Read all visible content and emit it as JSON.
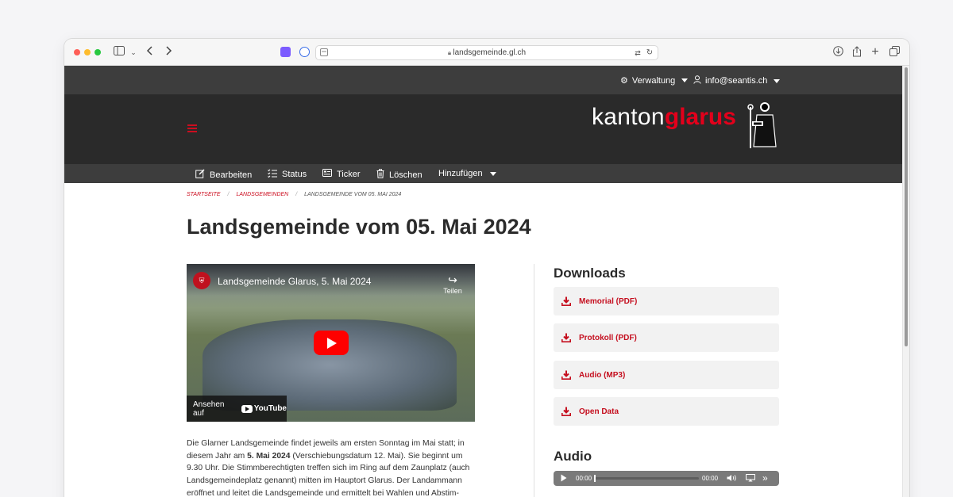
{
  "browser": {
    "url": "landsgemeinde.gl.ch"
  },
  "topbar": {
    "admin_label": "Verwaltung",
    "user_label": "info@seantis.ch"
  },
  "logo": {
    "part1": "kanton",
    "part2": "glarus"
  },
  "actions": [
    {
      "label": "Bearbeiten",
      "icon": "edit-icon"
    },
    {
      "label": "Status",
      "icon": "list-check-icon"
    },
    {
      "label": "Ticker",
      "icon": "ticker-icon"
    },
    {
      "label": "Löschen",
      "icon": "trash-icon"
    },
    {
      "label": "Hinzufügen",
      "icon": "chevron-down-icon"
    }
  ],
  "breadcrumb": [
    "Startseite",
    "Landsgemeinden",
    "Landsgemeinde vom 05. Mai 2024"
  ],
  "page_title": "Landsgemeinde vom 05. Mai 2024",
  "video": {
    "title": "Landsgemeinde Glarus, 5. Mai 2024",
    "share_label": "Teilen",
    "watch_label": "Ansehen auf",
    "platform": "YouTube"
  },
  "intro": {
    "p1": "Die Glarner Landsgemeinde findet jeweils am ersten Sonntag im Mai statt; in diesem Jahr am ",
    "date_bold": "5. Mai 2024",
    "p2": " (Verschiebungsdatum 12. Mai). Sie beginnt um 9.30 Uhr. Die Stimmberechtigten treffen sich im Ring auf dem Zaunplatz (auch Landsgemeindeplatz genannt) mitten im Hauptort Glarus. Der Landammann eröffnet und leitet die Landsgemeinde und ermittelt bei Wahlen und Abstim-"
  },
  "downloads": {
    "heading": "Downloads",
    "items": [
      "Memorial (PDF)",
      "Protokoll (PDF)",
      "Audio (MP3)",
      "Open Data"
    ]
  },
  "audio": {
    "heading": "Audio",
    "current_time": "00:00",
    "duration": "00:00",
    "progress": 0
  },
  "colors": {
    "accent": "#cc0d1f",
    "dark_header": "#2a2a2a",
    "nav_bar": "#3d3d3d"
  }
}
